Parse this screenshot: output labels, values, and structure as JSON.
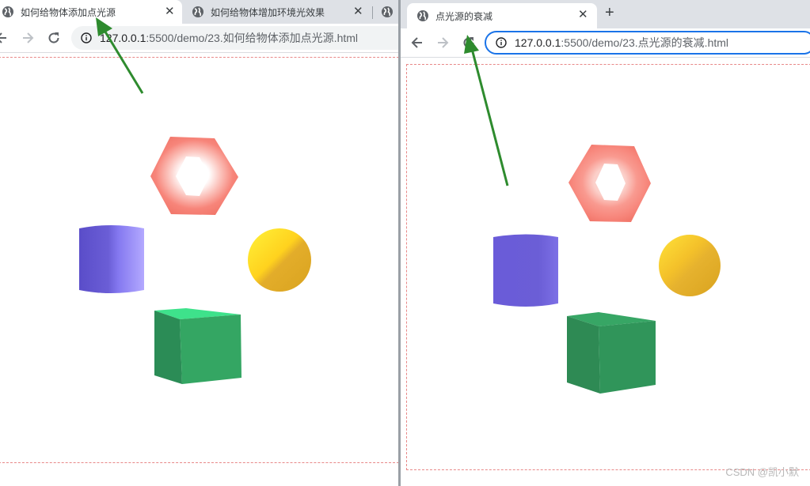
{
  "left_window": {
    "tabs": [
      {
        "title": "如何给物体添加点光源",
        "active": true
      },
      {
        "title": "如何给物体增加环境光效果",
        "active": false
      },
      {
        "title": "",
        "active": false
      }
    ],
    "url_host": "127.0.0.1",
    "url_path": ":5500/demo/23.如何给物体添加点光源.html"
  },
  "right_window": {
    "tabs": [
      {
        "title": "点光源的衰减",
        "active": true
      }
    ],
    "new_tab_label": "+",
    "url_host": "127.0.0.1",
    "url_path": ":5500/demo/23.点光源的衰减.html"
  },
  "close_glyph": "✕",
  "colors": {
    "torus": "#f7857a",
    "cylinder": "#6b5ed6",
    "sphere": "#e6b22e",
    "cube": "#329a5e",
    "annotation_arrow": "#2e8b2e",
    "canvas_border": "#e88888",
    "tab_strip": "#dee1e6",
    "focus_ring": "#1a73e8"
  },
  "icons": [
    "globe-icon",
    "back-arrow-icon",
    "forward-arrow-icon",
    "reload-icon",
    "info-icon",
    "close-icon",
    "plus-icon"
  ],
  "watermark": "CSDN @凯小默"
}
